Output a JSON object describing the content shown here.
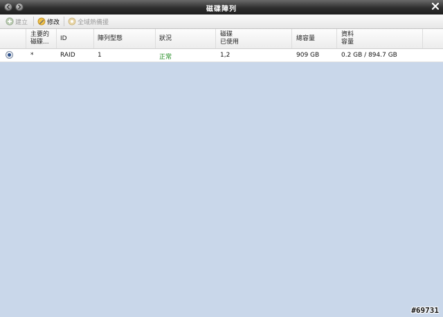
{
  "window": {
    "title": "磁碟陣列"
  },
  "toolbar": {
    "create_label": "建立",
    "edit_label": "修改",
    "hotspare_label": "全域熱備援"
  },
  "table": {
    "headers": {
      "primary_line1": "主要的",
      "primary_line2": "磁碟...",
      "id": "ID",
      "raid_type": "陣列型態",
      "status": "狀況",
      "disks_line1": "磁碟",
      "disks_line2": "已使用",
      "capacity": "總容量",
      "data_line1": "資料",
      "data_line2": "容量"
    },
    "rows": [
      {
        "primary": "*",
        "id": "RAID",
        "raid_type": "1",
        "status": "正常",
        "disks": "1,2",
        "capacity": "909 GB",
        "data_capacity": "0.2 GB / 894.7 GB",
        "selected": true
      }
    ]
  },
  "watermark": "#69731",
  "colors": {
    "status_ok": "#1e8a1e",
    "body_bg": "#c9d7ea"
  }
}
